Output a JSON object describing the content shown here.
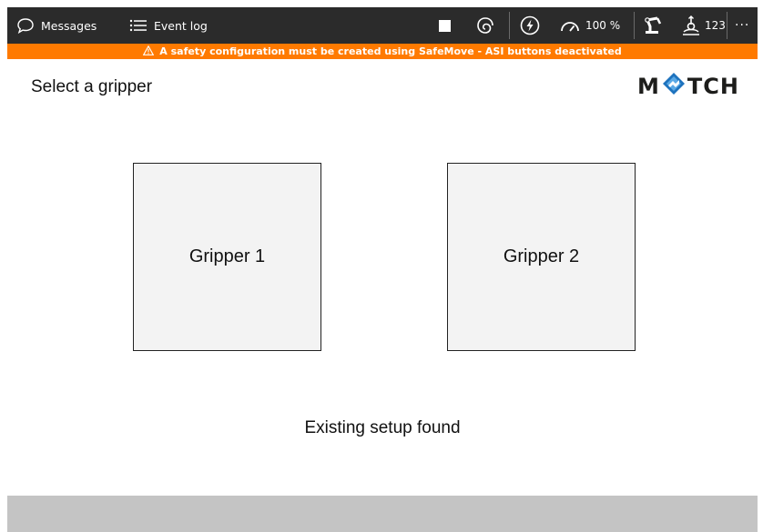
{
  "toolbar": {
    "messages_label": "Messages",
    "event_log_label": "Event log",
    "speed_value": "100 %",
    "tool_value": "123",
    "more_label": "···"
  },
  "warning": {
    "text": "A safety configuration must be created using SafeMove - ASI buttons deactivated"
  },
  "page": {
    "title": "Select a gripper",
    "logo_text_left": "M",
    "logo_text_right": "TCH"
  },
  "grippers": [
    {
      "label": "Gripper 1"
    },
    {
      "label": "Gripper 2"
    }
  ],
  "status": {
    "text": "Existing setup found"
  },
  "icons": {
    "messages": "speech-bubble-icon",
    "event_log": "list-icon",
    "stop": "stop-square-icon",
    "motion": "swirl-icon",
    "power": "lightning-circle-icon",
    "speed": "gauge-icon",
    "robot": "robot-arm-icon",
    "tool": "tool-frame-icon",
    "warning": "warning-triangle-icon"
  },
  "colors": {
    "toolbar_bg": "#2b2b2b",
    "warning_bg": "#ff7a00",
    "gripper_bg": "#f3f3f3",
    "bottom_bar_bg": "#c4c4c4",
    "logo_accent": "#1e73be"
  }
}
